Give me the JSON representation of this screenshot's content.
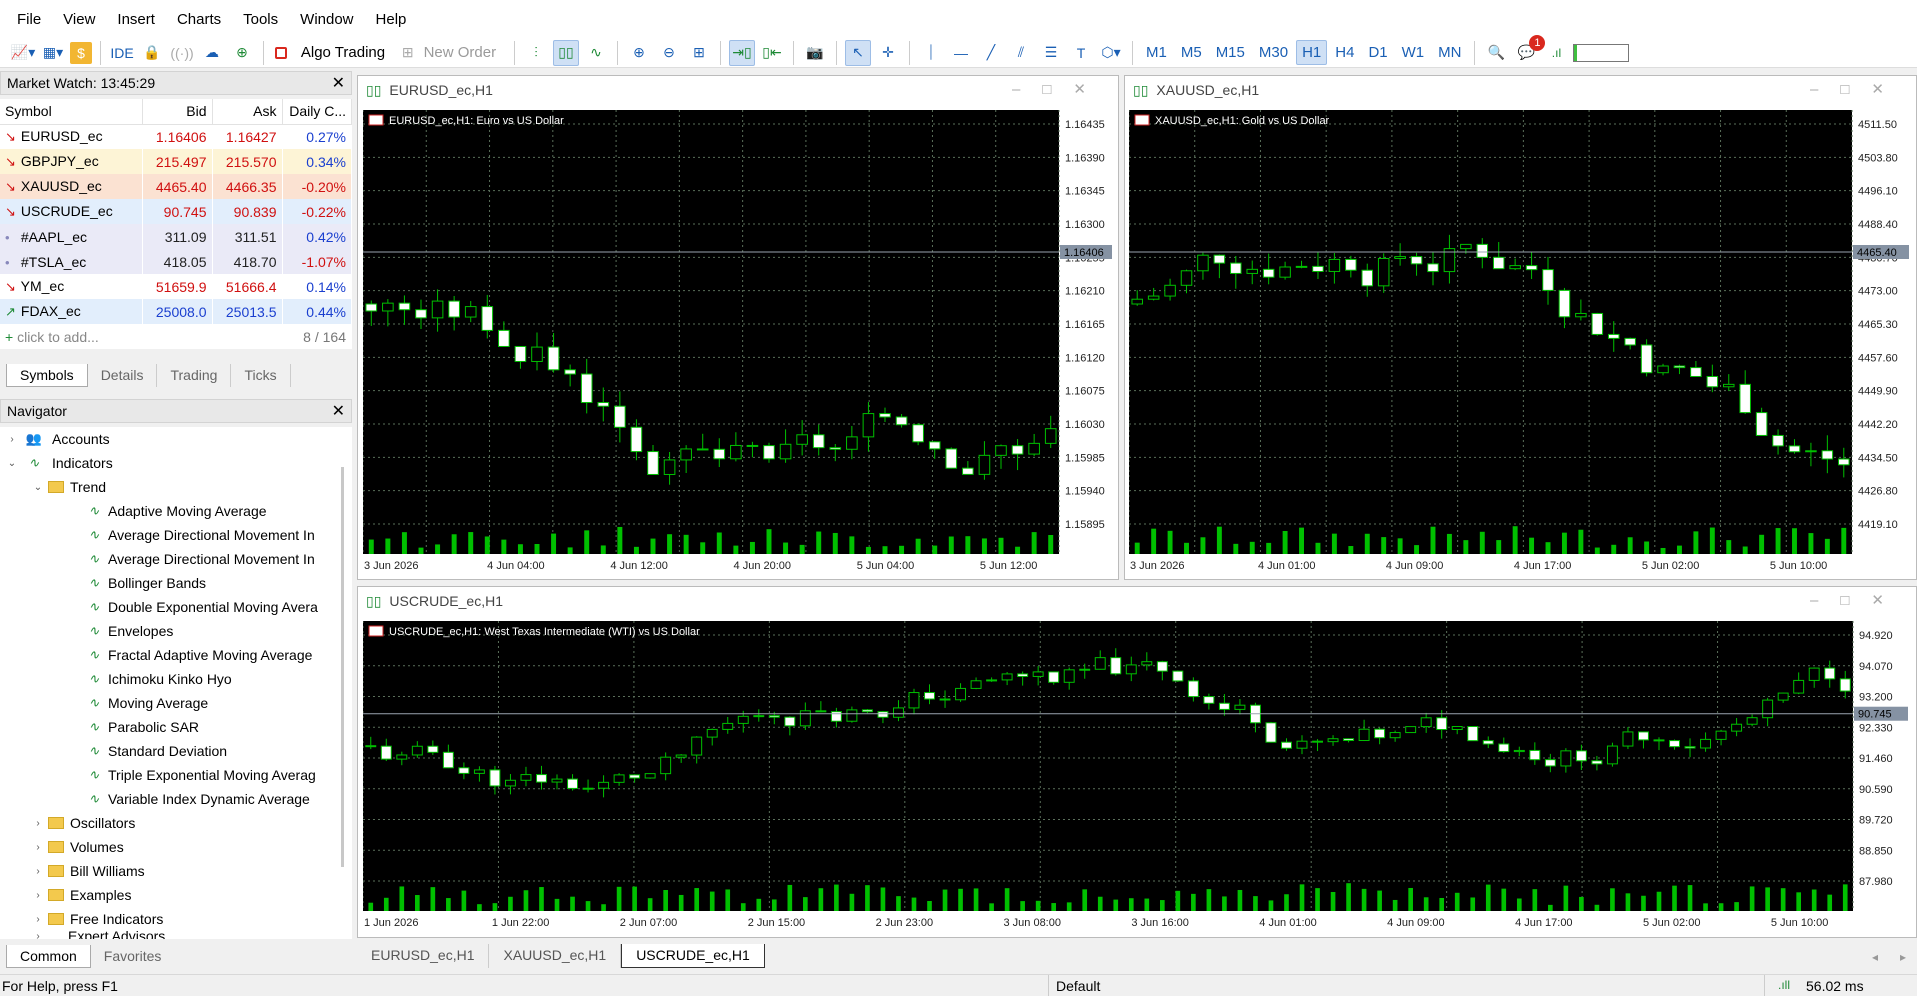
{
  "menu": [
    "File",
    "View",
    "Insert",
    "Charts",
    "Tools",
    "Window",
    "Help"
  ],
  "toolbar": {
    "algo_trading": "Algo Trading",
    "new_order": "New Order",
    "ide": "IDE",
    "timeframes": [
      "M1",
      "M5",
      "M15",
      "M30",
      "H1",
      "H4",
      "D1",
      "W1",
      "MN"
    ],
    "active_timeframe": "H1",
    "notification_count": "1"
  },
  "market_watch": {
    "title": "Market Watch: 13:45:29",
    "columns": [
      "Symbol",
      "Bid",
      "Ask",
      "Daily C..."
    ],
    "rows": [
      {
        "symbol": "EURUSD_ec",
        "bid": "1.16406",
        "ask": "1.16427",
        "change": "0.27%",
        "dir": "down",
        "bg": "#ffffff",
        "bidc": "#d01010",
        "askc": "#d01010",
        "chc": "#1a3fcf"
      },
      {
        "symbol": "GBPJPY_ec",
        "bid": "215.497",
        "ask": "215.570",
        "change": "0.34%",
        "dir": "down",
        "bg": "#fdf4d6",
        "bidc": "#d01010",
        "askc": "#d01010",
        "chc": "#1a3fcf"
      },
      {
        "symbol": "XAUUSD_ec",
        "bid": "4465.40",
        "ask": "4466.35",
        "change": "-0.20%",
        "dir": "down",
        "bg": "#fbe2d2",
        "bidc": "#d01010",
        "askc": "#d01010",
        "chc": "#d01010"
      },
      {
        "symbol": "USCRUDE_ec",
        "bid": "90.745",
        "ask": "90.839",
        "change": "-0.22%",
        "dir": "down",
        "bg": "#e2eefc",
        "bidc": "#d01010",
        "askc": "#d01010",
        "chc": "#d01010"
      },
      {
        "symbol": "#AAPL_ec",
        "bid": "311.09",
        "ask": "311.51",
        "change": "0.42%",
        "dir": "none",
        "bg": "#eaeaf7",
        "bidc": "#222222",
        "askc": "#222222",
        "chc": "#1a3fcf"
      },
      {
        "symbol": "#TSLA_ec",
        "bid": "418.05",
        "ask": "418.70",
        "change": "-1.07%",
        "dir": "none",
        "bg": "#eaeaf7",
        "bidc": "#222222",
        "askc": "#222222",
        "chc": "#d01010"
      },
      {
        "symbol": "YM_ec",
        "bid": "51659.9",
        "ask": "51666.4",
        "change": "0.14%",
        "dir": "down",
        "bg": "#ffffff",
        "bidc": "#d01010",
        "askc": "#d01010",
        "chc": "#1a3fcf"
      },
      {
        "symbol": "FDAX_ec",
        "bid": "25008.0",
        "ask": "25013.5",
        "change": "0.44%",
        "dir": "up",
        "bg": "#e2eefc",
        "bidc": "#1a3fcf",
        "askc": "#1a3fcf",
        "chc": "#1a3fcf"
      }
    ],
    "add_label": "click to add...",
    "count": "8 / 164",
    "tabs": [
      "Symbols",
      "Details",
      "Trading",
      "Ticks"
    ]
  },
  "navigator": {
    "title": "Navigator",
    "accounts": "Accounts",
    "indicators": "Indicators",
    "trend": "Trend",
    "trend_items": [
      "Adaptive Moving Average",
      "Average Directional Movement In",
      "Average Directional Movement In",
      "Bollinger Bands",
      "Double Exponential Moving Avera",
      "Envelopes",
      "Fractal Adaptive Moving Average",
      "Ichimoku Kinko Hyo",
      "Moving Average",
      "Parabolic SAR",
      "Standard Deviation",
      "Triple Exponential Moving Averag",
      "Variable Index Dynamic Average"
    ],
    "folders": [
      "Oscillators",
      "Volumes",
      "Bill Williams",
      "Examples",
      "Free Indicators"
    ],
    "partial": "Expert Advisors",
    "tabs": [
      "Common",
      "Favorites"
    ]
  },
  "charts": [
    {
      "window_title": "EURUSD_ec,H1",
      "label": "EURUSD_ec,H1:  Euro vs US Dollar",
      "price_ticks": [
        "1.16435",
        "1.16390",
        "1.16345",
        "1.16300",
        "1.16255",
        "1.16210",
        "1.16165",
        "1.16120",
        "1.16075",
        "1.16030",
        "1.15985",
        "1.15940",
        "1.15895"
      ],
      "current": "1.16406",
      "time_ticks": [
        "3 Jun 2026",
        "4 Jun 04:00",
        "4 Jun 12:00",
        "4 Jun 20:00",
        "5 Jun 04:00",
        "5 Jun 12:00"
      ]
    },
    {
      "window_title": "XAUUSD_ec,H1",
      "label": "XAUUSD_ec,H1:  Gold vs US Dollar",
      "price_ticks": [
        "4511.50",
        "4503.80",
        "4496.10",
        "4488.40",
        "4480.70",
        "4473.00",
        "4465.30",
        "4457.60",
        "4449.90",
        "4442.20",
        "4434.50",
        "4426.80",
        "4419.10"
      ],
      "current": "4465.40",
      "time_ticks": [
        "3 Jun 2026",
        "4 Jun 01:00",
        "4 Jun 09:00",
        "4 Jun 17:00",
        "5 Jun 02:00",
        "5 Jun 10:00"
      ]
    },
    {
      "window_title": "USCRUDE_ec,H1",
      "label": "USCRUDE_ec,H1:  West Texas Intermediate (WTI) vs US Dollar",
      "price_ticks": [
        "94.920",
        "94.070",
        "93.200",
        "92.330",
        "91.460",
        "90.590",
        "89.720",
        "88.850",
        "87.980"
      ],
      "current": "90.745",
      "time_ticks": [
        "1 Jun 2026",
        "1 Jun 22:00",
        "2 Jun 07:00",
        "2 Jun 15:00",
        "2 Jun 23:00",
        "3 Jun 08:00",
        "3 Jun 16:00",
        "4 Jun 01:00",
        "4 Jun 09:00",
        "4 Jun 17:00",
        "5 Jun 02:00",
        "5 Jun 10:00"
      ]
    }
  ],
  "chart_tabs": [
    "EURUSD_ec,H1",
    "XAUUSD_ec,H1",
    "USCRUDE_ec,H1"
  ],
  "active_chart_tab": "USCRUDE_ec,H1",
  "status": {
    "help": "For Help, press F1",
    "profile": "Default",
    "ping": "56.02 ms"
  },
  "colors": {
    "chart_bg": "#000000",
    "bull": "#00c000",
    "bear": "#ffffff",
    "grid": "#5a6f5a",
    "accent": "#1a5fb4"
  }
}
